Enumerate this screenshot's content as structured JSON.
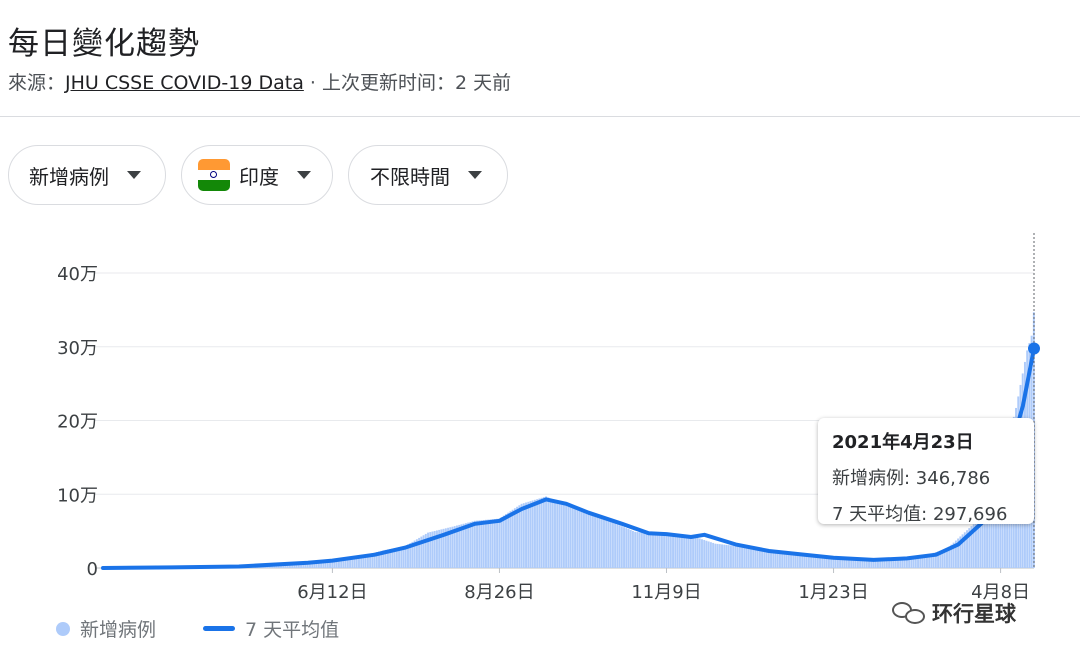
{
  "header": {
    "title": "每日變化趨勢",
    "source_prefix": "來源：",
    "source_link": "JHU CSSE COVID-19 Data",
    "source_suffix": " · 上次更新时间：2 天前"
  },
  "filters": {
    "metric": "新增病例",
    "country": "印度",
    "time": "不限時間"
  },
  "tooltip": {
    "date": "2021年4月23日",
    "cases_label": "新增病例: 346,786",
    "avg_label": "7 天平均值: 297,696"
  },
  "legend": {
    "cases": "新增病例",
    "average": "7 天平均值"
  },
  "watermark": "环行星球",
  "colors": {
    "bars": "#aecbfa",
    "line": "#1a73e8",
    "grid": "#e8eaed"
  },
  "chart_data": {
    "type": "bar",
    "title": "",
    "xlabel": "",
    "ylabel": "",
    "ylim": [
      0,
      400000
    ],
    "y_ticks": [
      {
        "value": 0,
        "label": "0"
      },
      {
        "value": 100000,
        "label": "10万"
      },
      {
        "value": 200000,
        "label": "20万"
      },
      {
        "value": 300000,
        "label": "30万"
      },
      {
        "value": 400000,
        "label": "40万"
      }
    ],
    "x_range": [
      "2020-03-01",
      "2021-04-23"
    ],
    "x_ticks": [
      {
        "date": "2020-06-12",
        "label": "6月12日"
      },
      {
        "date": "2020-08-26",
        "label": "8月26日"
      },
      {
        "date": "2020-11-09",
        "label": "11月9日"
      },
      {
        "date": "2021-01-23",
        "label": "1月23日"
      },
      {
        "date": "2021-04-08",
        "label": "4月8日"
      }
    ],
    "series": [
      {
        "name": "新增病例",
        "type": "bar",
        "points": [
          [
            "2020-03-01",
            0
          ],
          [
            "2020-04-01",
            1000
          ],
          [
            "2020-04-15",
            1200
          ],
          [
            "2020-05-01",
            2000
          ],
          [
            "2020-05-15",
            4000
          ],
          [
            "2020-06-01",
            8000
          ],
          [
            "2020-06-12",
            11000
          ],
          [
            "2020-06-26",
            17000
          ],
          [
            "2020-07-05",
            24000
          ],
          [
            "2020-07-15",
            30000
          ],
          [
            "2020-07-25",
            48000
          ],
          [
            "2020-08-05",
            56000
          ],
          [
            "2020-08-15",
            64000
          ],
          [
            "2020-08-26",
            67000
          ],
          [
            "2020-09-05",
            87000
          ],
          [
            "2020-09-16",
            97000
          ],
          [
            "2020-09-25",
            85000
          ],
          [
            "2020-10-05",
            74000
          ],
          [
            "2020-10-15",
            63000
          ],
          [
            "2020-10-26",
            49000
          ],
          [
            "2020-11-09",
            45000
          ],
          [
            "2020-11-20",
            44000
          ],
          [
            "2020-12-01",
            33000
          ],
          [
            "2020-12-10",
            30000
          ],
          [
            "2020-12-20",
            24000
          ],
          [
            "2020-12-31",
            20000
          ],
          [
            "2021-01-10",
            18000
          ],
          [
            "2021-01-23",
            14000
          ],
          [
            "2021-02-05",
            12000
          ],
          [
            "2021-02-20",
            14000
          ],
          [
            "2021-03-05",
            17000
          ],
          [
            "2021-03-15",
            26000
          ],
          [
            "2021-03-25",
            54000
          ],
          [
            "2021-04-01",
            73000
          ],
          [
            "2021-04-08",
            132000
          ],
          [
            "2021-04-15",
            217000
          ],
          [
            "2021-04-20",
            295000
          ],
          [
            "2021-04-22",
            315000
          ],
          [
            "2021-04-23",
            346786
          ]
        ]
      },
      {
        "name": "7 天平均值",
        "type": "line",
        "points": [
          [
            "2020-03-01",
            0
          ],
          [
            "2020-04-01",
            800
          ],
          [
            "2020-05-01",
            2000
          ],
          [
            "2020-06-01",
            7000
          ],
          [
            "2020-06-12",
            10000
          ],
          [
            "2020-07-01",
            18000
          ],
          [
            "2020-07-15",
            28000
          ],
          [
            "2020-08-01",
            45000
          ],
          [
            "2020-08-15",
            60000
          ],
          [
            "2020-08-26",
            64000
          ],
          [
            "2020-09-05",
            80000
          ],
          [
            "2020-09-16",
            93000
          ],
          [
            "2020-09-25",
            87000
          ],
          [
            "2020-10-05",
            75000
          ],
          [
            "2020-10-20",
            60000
          ],
          [
            "2020-11-01",
            47000
          ],
          [
            "2020-11-09",
            46000
          ],
          [
            "2020-11-20",
            42000
          ],
          [
            "2020-11-26",
            45000
          ],
          [
            "2020-12-10",
            32000
          ],
          [
            "2020-12-25",
            23000
          ],
          [
            "2021-01-10",
            18000
          ],
          [
            "2021-01-23",
            14000
          ],
          [
            "2021-02-10",
            11000
          ],
          [
            "2021-02-25",
            13000
          ],
          [
            "2021-03-10",
            18000
          ],
          [
            "2021-03-20",
            32000
          ],
          [
            "2021-04-01",
            65000
          ],
          [
            "2021-04-10",
            135000
          ],
          [
            "2021-04-18",
            220000
          ],
          [
            "2021-04-23",
            297696
          ]
        ]
      }
    ],
    "legend_position": "bottom-left",
    "grid": true
  }
}
